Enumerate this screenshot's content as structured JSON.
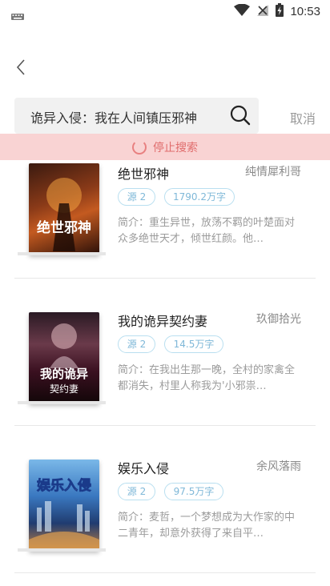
{
  "status_bar": {
    "time": "10:53"
  },
  "search": {
    "query": "诡异入侵：我在人间镇压邪神",
    "cancel_label": "取消"
  },
  "stop_bar": {
    "label": "停止搜索"
  },
  "books": [
    {
      "title": "绝世邪神",
      "author": "纯情犀利哥",
      "source": "源 2",
      "word_count": "1790.2万字",
      "intro": "简介：重生异世，放荡不羁的叶楚面对众多绝世天才，倾世红颜。他…",
      "cover_text": "绝世邪神"
    },
    {
      "title": "我的诡异契约妻",
      "author": "玖御拾光",
      "source": "源 2",
      "word_count": "14.5万字",
      "intro": "简介：在我出生那一晚，全村的家禽全都消失，村里人称我为'小邪祟…",
      "cover_text": "我的诡异契约妻"
    },
    {
      "title": "娱乐入侵",
      "author": "余风落雨",
      "source": "源 2",
      "word_count": "97.5万字",
      "intro": "简介：麦哲，一个梦想成为大作家的中二青年，却意外获得了来自平…",
      "cover_text": "娱乐入侵"
    }
  ],
  "colors": {
    "stop_bg": "#f9d3d3",
    "stop_text": "#e06c6c",
    "tag_border": "#b9dff0",
    "tag_text": "#7fb8d8"
  }
}
